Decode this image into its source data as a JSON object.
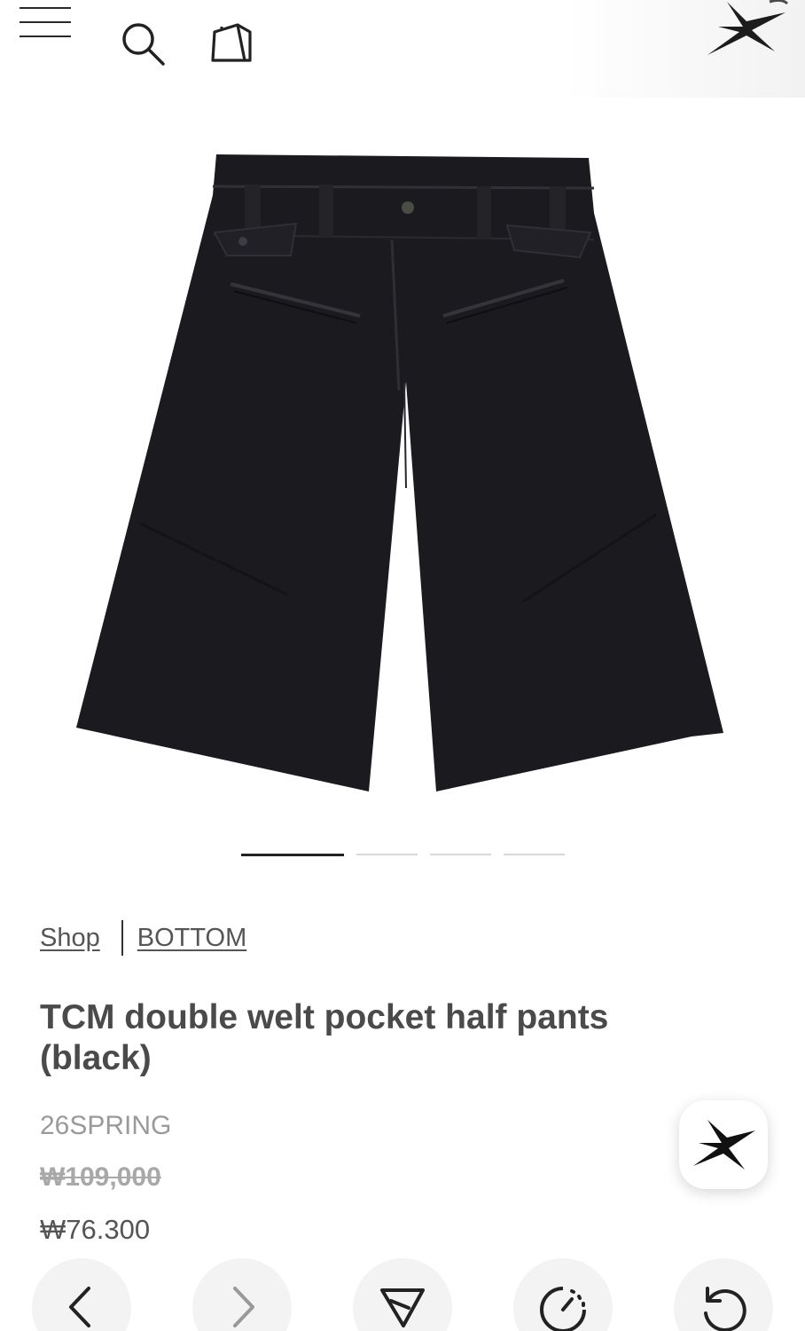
{
  "header": {
    "menu_icon": "hamburger-menu-icon",
    "search_icon": "search-icon",
    "bag_icon": "shopping-bag-icon",
    "logo_icon": "starfish-logo-icon"
  },
  "gallery": {
    "image_subject": "black double welt pocket half pants",
    "slide_count": 4,
    "active_slide": 1
  },
  "breadcrumb": {
    "shop_label": "Shop",
    "category_label": "BOTTOM"
  },
  "product": {
    "title": "TCM double welt pocket half pants (black)",
    "season": "26SPRING",
    "original_price": "₩109,000",
    "sale_price": "₩76.300"
  },
  "fab": {
    "icon": "starfish-icon"
  },
  "toolbar": {
    "buttons": [
      {
        "icon": "chevron-left-icon"
      },
      {
        "icon": "chevron-right-icon"
      },
      {
        "icon": "send-icon"
      },
      {
        "icon": "timer-icon"
      },
      {
        "icon": "reload-icon"
      }
    ]
  },
  "colors": {
    "text": "#4a4a4a",
    "muted": "#9a9a9a",
    "garment": "#1b1b1f"
  }
}
